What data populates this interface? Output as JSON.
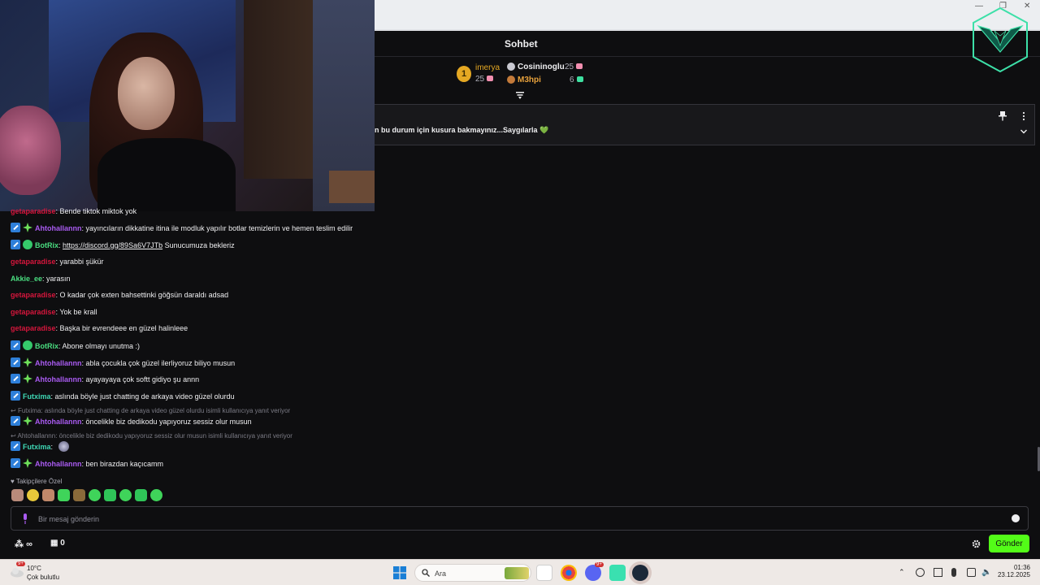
{
  "chat_header": {
    "title": "Sohbet"
  },
  "leaderboard": {
    "first": {
      "rank": "1",
      "name": "imerya",
      "points": "25"
    },
    "second": {
      "name": "Cosininoglu",
      "points": "25"
    },
    "third": {
      "name": "M3hpi",
      "points": "6"
    }
  },
  "pinned": {
    "text": "n bu durum için kusura bakmayınız...Saygılarla 💚"
  },
  "messages": [
    {
      "user": "getaparadise",
      "text": ": Bende tiktok miktok yok"
    },
    {
      "user": "Ahtohallannn",
      "text": ": yayıncıların dikkatine itina ile modluk yapılır botlar temizlerin ve hemen teslim edilir"
    },
    {
      "user": "BotRix",
      "text": ": ",
      "link": "https://discord.gg/89Sa6V7JTb",
      "text2": " Sunucumuza bekleriz"
    },
    {
      "user": "getaparadise",
      "text": ": yarabbi şükür"
    },
    {
      "user": "Akkie_ee",
      "text": ": yarasın"
    },
    {
      "user": "getaparadise",
      "text": ": O kadar çok exten bahsettinki göğsün daraldı adsad"
    },
    {
      "user": "getaparadise",
      "text": ": Yok be krall"
    },
    {
      "user": "getaparadise",
      "text": ": Başka bir evrendeee en güzel halinleee"
    },
    {
      "user": "BotRix",
      "text": ": Abone olmayı unutma :)"
    },
    {
      "user": "Ahtohallannn",
      "text": ": abla çocukla çok güzel ilerliyoruz biliyo musun"
    },
    {
      "user": "Ahtohallannn",
      "text": ": ayayayaya çok softt gidiyo şu annn"
    },
    {
      "user": "Futxima",
      "text": ": aslında böyle just chatting de arkaya video güzel olurdu"
    },
    {
      "reply": "Futxima: aslında böyle just chatting de arkaya video güzel olurdu isimli kullanıcıya yanıt veriyor"
    },
    {
      "user": "Ahtohallannn",
      "text": ": öncelikle biz dedikodu yapıyoruz sessiz olur musun"
    },
    {
      "reply": "Ahtohallannn: öncelikle biz dedikodu yapıyoruz sessiz olur musun isimli kullanıcıya yanıt veriyor"
    },
    {
      "user": "Futxima",
      "text": ":"
    },
    {
      "user": "Ahtohallannn",
      "text": ": ben birazdan kaçıcamm"
    }
  ],
  "emotes_label": "Takipçilere Özel",
  "input": {
    "placeholder": "Bir mesaj gönderin"
  },
  "bottom": {
    "points": "∞",
    "store_count": "0",
    "send_label": "Gönder"
  },
  "taskbar": {
    "weather_temp": "10°C",
    "weather_cond": "Çok bulutlu",
    "weather_badge": "9+",
    "search_label": "Ara",
    "discord_badge": "9+",
    "time": "01:36",
    "date": "23.12.2025"
  },
  "colors": {
    "accent": "#53fc18",
    "mod_badge": "#2e7fd9",
    "user_purple": "#a95bf1",
    "user_red": "#d6163c",
    "user_green": "#4ade80"
  }
}
